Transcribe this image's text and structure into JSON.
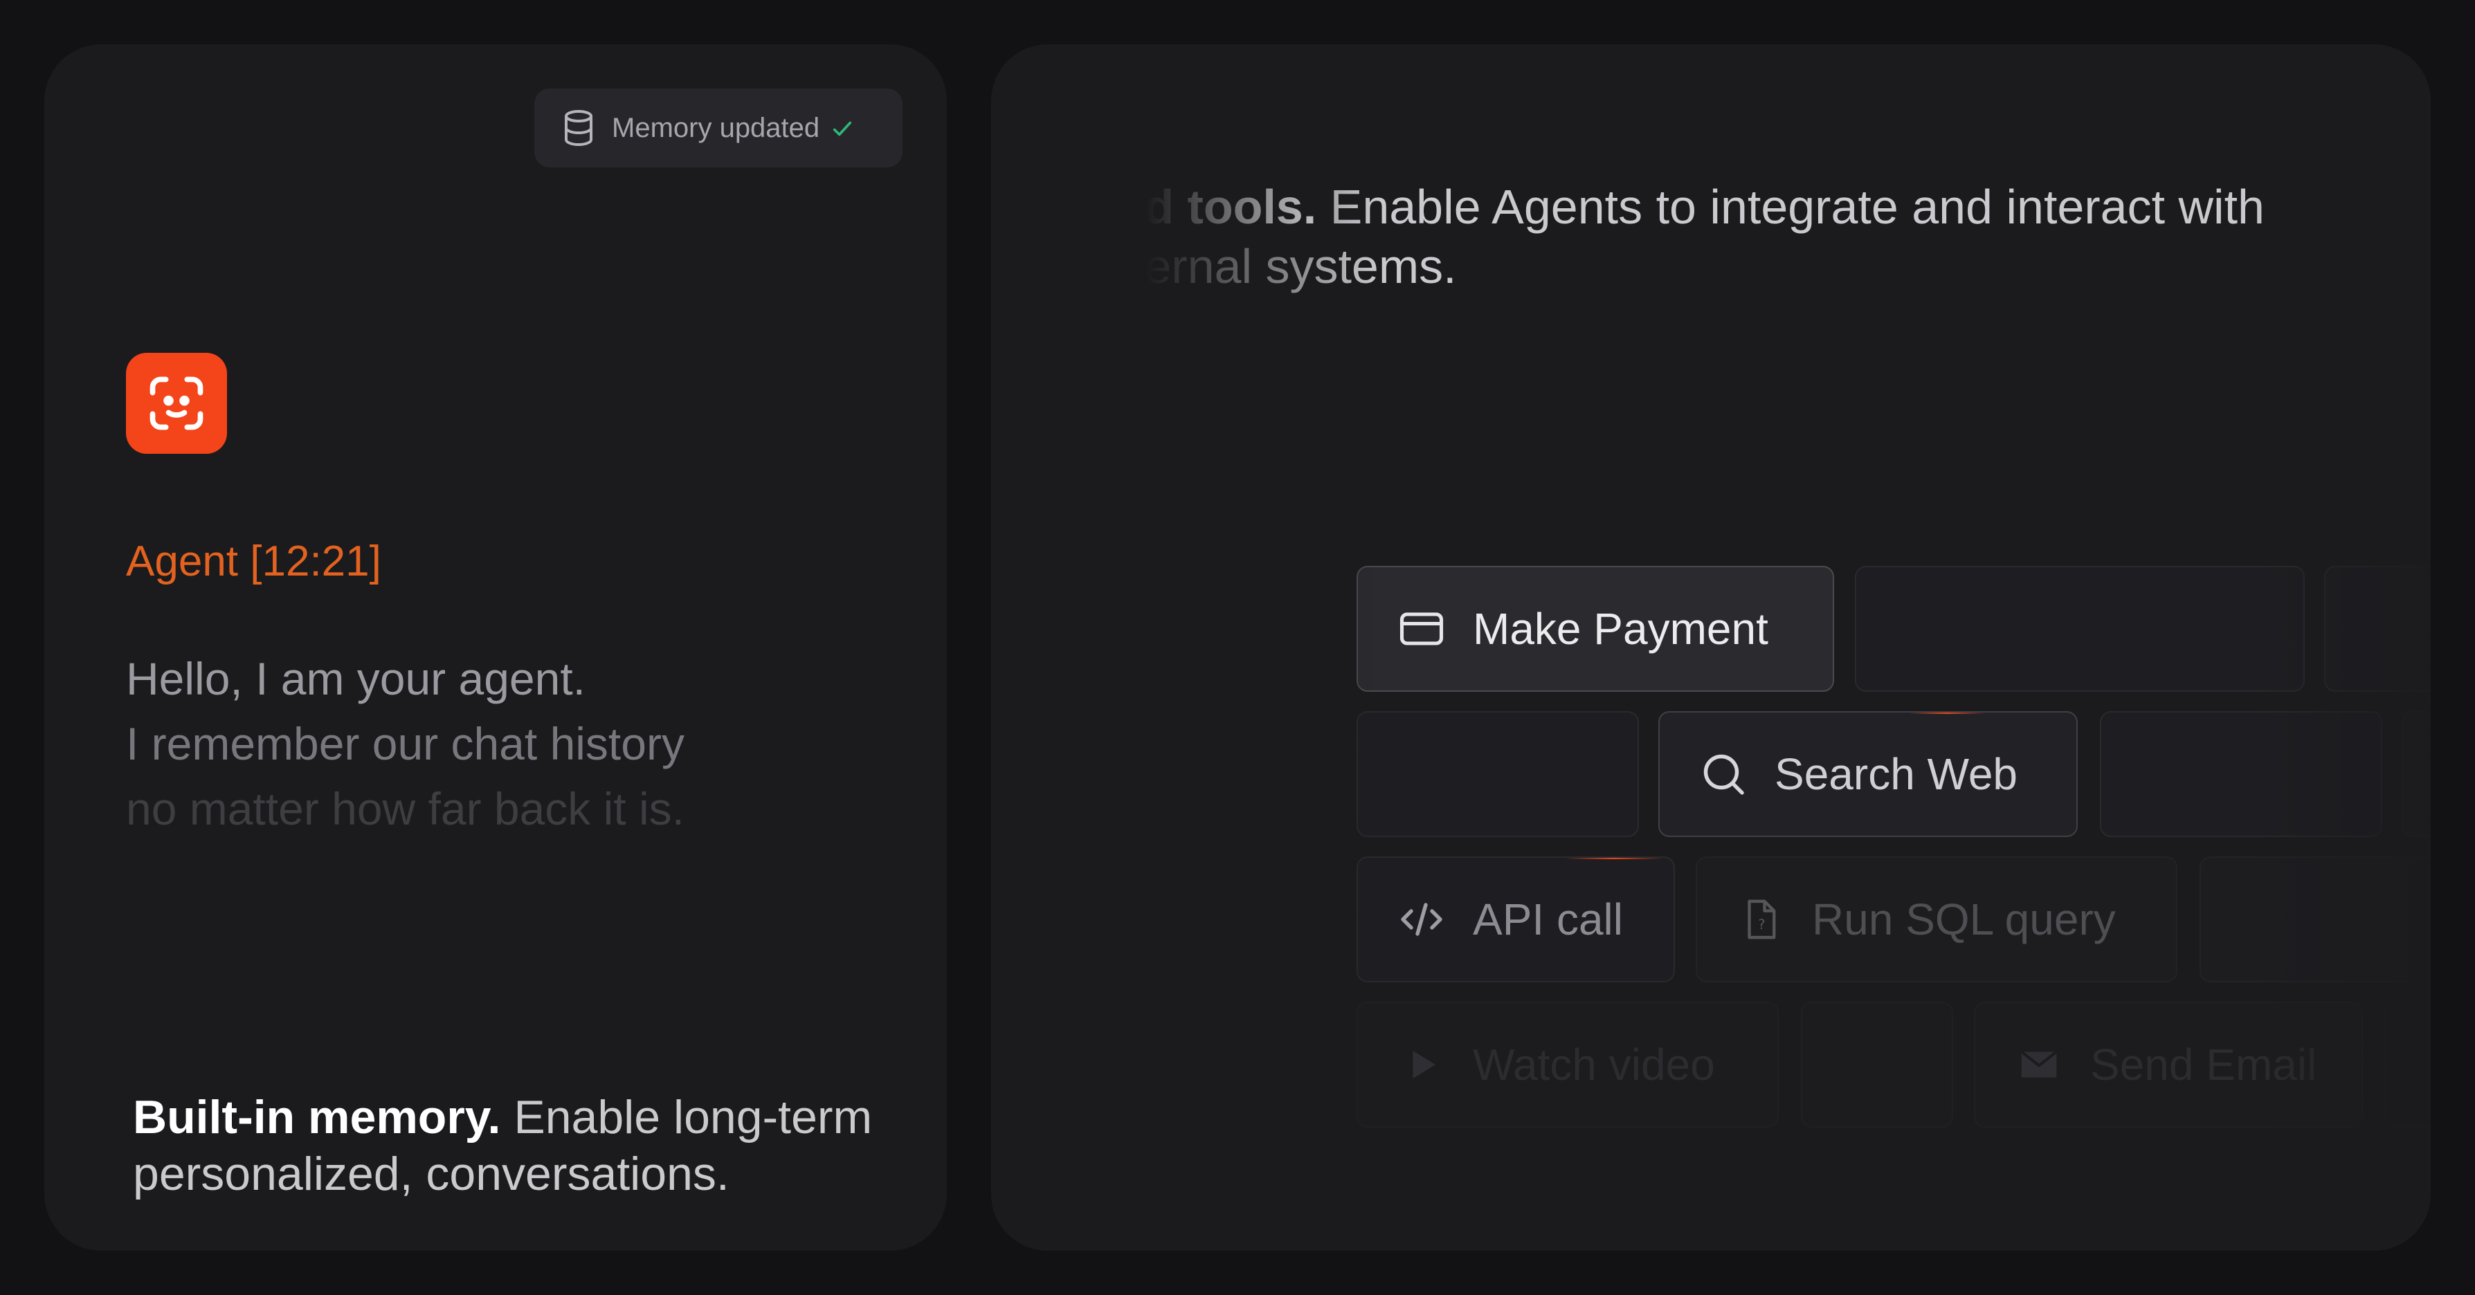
{
  "memory_card": {
    "badge": {
      "icon": "database-icon",
      "label": "Memory updated",
      "status_icon": "check-icon",
      "status_color": "#2fb87a"
    },
    "agent": {
      "avatar_icon": "face-scan-icon",
      "avatar_color": "#f4441a",
      "name": "Agent [12:21]",
      "name_color": "#e3621f"
    },
    "messages": [
      "Hello, I am your agent.",
      "I remember our chat history",
      "no matter how far back it is."
    ],
    "caption_bold": "Built-in memory.",
    "caption_rest": " Enable long-term personalized, conversations."
  },
  "tools_card": {
    "caption_bold": "Add tools.",
    "caption_rest": " Enable Agents to integrate and interact with external systems.",
    "tools": [
      {
        "label": "Make Payment",
        "icon": "credit-card-icon"
      },
      {
        "label": "Search Web",
        "icon": "search-icon"
      },
      {
        "label": "API call",
        "icon": "code-icon"
      },
      {
        "label": "Run SQL query",
        "icon": "file-question-icon"
      },
      {
        "label": "Watch video",
        "icon": "play-icon"
      },
      {
        "label": "Send Email",
        "icon": "mail-icon"
      }
    ],
    "accent": "#f4441a"
  }
}
